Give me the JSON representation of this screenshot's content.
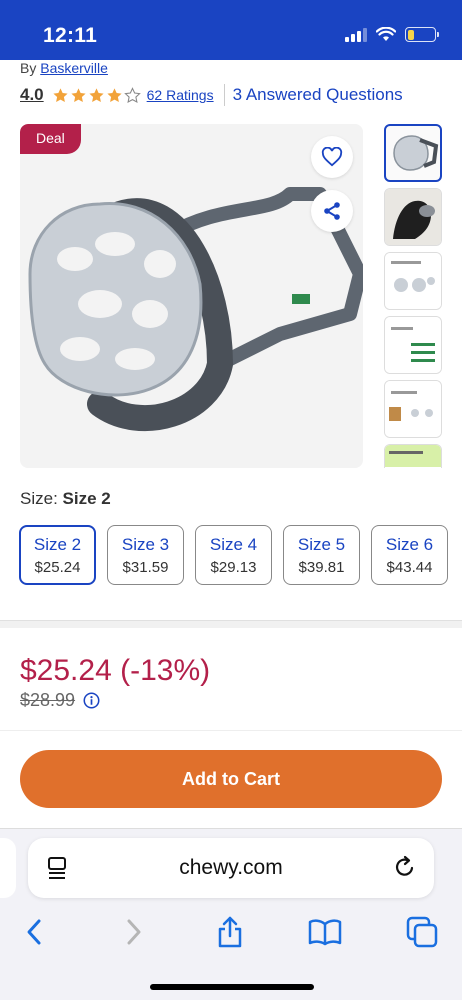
{
  "status": {
    "time": "12:11"
  },
  "product": {
    "by_prefix": "By ",
    "brand": "Baskerville",
    "rating": "4.0",
    "ratings_count": "62 Ratings",
    "answered_questions": "3 Answered Questions",
    "deal_badge": "Deal"
  },
  "size": {
    "label": "Size: ",
    "selected": "Size 2",
    "options": [
      {
        "name": "Size 2",
        "price": "$25.24"
      },
      {
        "name": "Size 3",
        "price": "$31.59"
      },
      {
        "name": "Size 4",
        "price": "$29.13"
      },
      {
        "name": "Size 5",
        "price": "$39.81"
      },
      {
        "name": "Size 6",
        "price": "$43.44"
      }
    ]
  },
  "pricing": {
    "current": "$25.24 (-13%)",
    "original": "$28.99"
  },
  "cart": {
    "button_label": "Add to Cart"
  },
  "browser": {
    "url": "chewy.com"
  },
  "colors": {
    "brand_blue": "#1a44c2",
    "deal_red": "#b3204a",
    "cart_orange": "#e0702c"
  }
}
